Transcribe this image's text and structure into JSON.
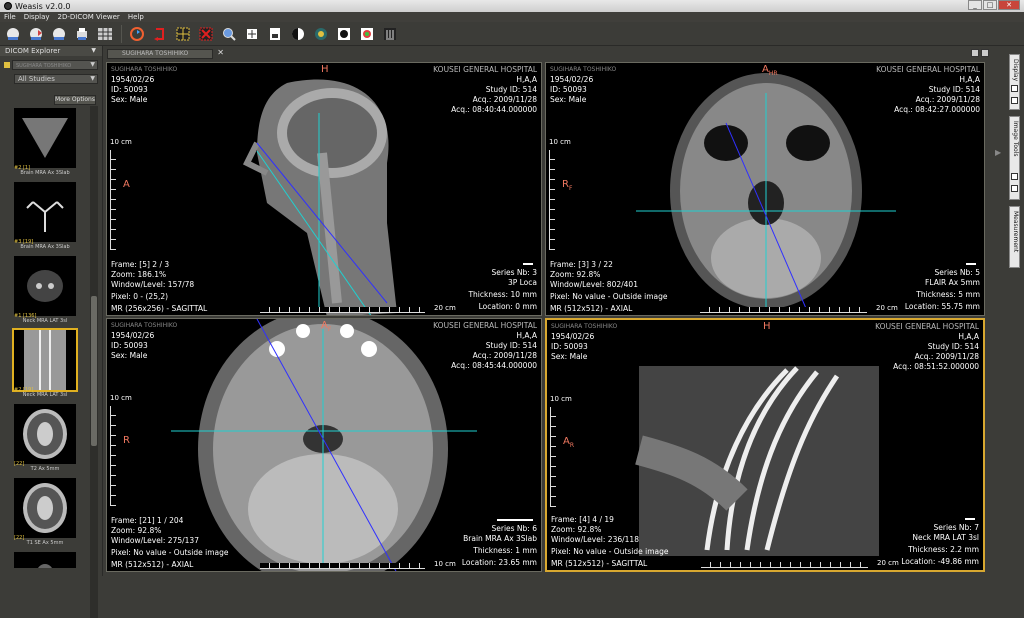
{
  "window": {
    "title": "Weasis v2.0.0"
  },
  "menu": [
    "File",
    "Display",
    "2D-DICOM Viewer",
    "Help"
  ],
  "toolbar": {
    "icons": [
      "open-dicom-icon",
      "import-dicom-icon",
      "export-dicom-icon",
      "print-icon",
      "layout-grid-icon",
      "synchronize-icon",
      "reset-icon",
      "crosshair-icon",
      "delete-icon",
      "zoom-icon",
      "pan-icon",
      "save-icon",
      "contrast-icon",
      "lut-icon",
      "invert-icon",
      "color-lut-icon",
      "filter-icon"
    ]
  },
  "left_panel": {
    "title": "DICOM Explorer",
    "patient": "SUGIHARA TOSHIHIKO",
    "studies": "All Studies",
    "more_options": "More Options",
    "thumbnails": [
      {
        "count": "#2 [1]",
        "label": "Brain MRA Ax 3Slab"
      },
      {
        "count": "#3 [19]",
        "label": "Brain MRA Ax 3Slab"
      },
      {
        "count": "#1 [136]",
        "label": "Neck MRA LAT 3sl"
      },
      {
        "count": "#2 [19]",
        "label": "Neck MRA LAT 3sl"
      },
      {
        "count": "[22]",
        "label": "T2 Ax 5mm"
      },
      {
        "count": "[22]",
        "label": "T1 SE Ax 5mm"
      },
      {
        "count": "",
        "label": ""
      }
    ]
  },
  "tab": {
    "label": "SUGIHARA TOSHIHIKO"
  },
  "viewports": [
    {
      "patient": "SUGIHARA TOSHIHIKO",
      "dob": "1954/02/26",
      "id": "ID: 50093",
      "sex": "Sex: Male",
      "hospital": "KOUSEI GENERAL HOSPITAL",
      "code": "H,A,A",
      "study_id": "Study ID: 514",
      "acq_date": "Acq.: 2009/11/28",
      "acq_time": "Acq.: 08:40:44.000000",
      "frame": "Frame: [5] 2 / 3",
      "zoom": "Zoom: 186.1%",
      "wl": "Window/Level: 157/78",
      "pixel": "Pixel: 0 - (25,2)",
      "mr": "MR (256x256) - SAGITTAL",
      "series": "Series Nb: 3",
      "series_desc": "3P Loca",
      "thickness": "Thickness: 10 mm",
      "location": "Location: 0 mm",
      "orient_top": "H",
      "orient_left": "A",
      "orient_top_sub": "",
      "orient_left_sub": "",
      "scale_v": "10 cm",
      "scale_h": "20 cm"
    },
    {
      "patient": "SUGIHARA TOSHIHIKO",
      "dob": "1954/02/26",
      "id": "ID: 50093",
      "sex": "Sex: Male",
      "hospital": "KOUSEI GENERAL HOSPITAL",
      "code": "H,A,A",
      "study_id": "Study ID: 514",
      "acq_date": "Acq.: 2009/11/28",
      "acq_time": "Acq.: 08:42:27.000000",
      "frame": "Frame: [3] 3 / 22",
      "zoom": "Zoom: 92.8%",
      "wl": "Window/Level: 802/401",
      "pixel": "Pixel: No value - Outside image",
      "mr": "MR (512x512) - AXIAL",
      "series": "Series Nb: 5",
      "series_desc": "FLAIR Ax 5mm",
      "thickness": "Thickness: 5 mm",
      "location": "Location: 55.75 mm",
      "orient_top": "A",
      "orient_left": "R",
      "orient_top_sub": "HR",
      "orient_left_sub": "F",
      "scale_v": "10 cm",
      "scale_h": "20 cm"
    },
    {
      "patient": "SUGIHARA TOSHIHIKO",
      "dob": "1954/02/26",
      "id": "ID: 50093",
      "sex": "Sex: Male",
      "hospital": "KOUSEI GENERAL HOSPITAL",
      "code": "H,A,A",
      "study_id": "Study ID: 514",
      "acq_date": "Acq.: 2009/11/28",
      "acq_time": "Acq.: 08:45:44.000000",
      "frame": "Frame: [21] 1 / 204",
      "zoom": "Zoom: 92.8%",
      "wl": "Window/Level: 275/137",
      "pixel": "Pixel: No value - Outside image",
      "mr": "MR (512x512) - AXIAL",
      "series": "Series Nb: 6",
      "series_desc": "Brain MRA Ax 3Slab",
      "thickness": "Thickness: 1 mm",
      "location": "Location: 23.65 mm",
      "orient_top": "A",
      "orient_left": "R",
      "orient_top_sub": "F",
      "orient_left_sub": "",
      "scale_v": "10 cm",
      "scale_h": "10 cm"
    },
    {
      "patient": "SUGIHARA TOSHIHIKO",
      "dob": "1954/02/26",
      "id": "ID: 50093",
      "sex": "Sex: Male",
      "hospital": "KOUSEI GENERAL HOSPITAL",
      "code": "H,A,A",
      "study_id": "Study ID: 514",
      "acq_date": "Acq.: 2009/11/28",
      "acq_time": "Acq.: 08:51:52.000000",
      "frame": "Frame: [4] 4 / 19",
      "zoom": "Zoom: 92.8%",
      "wl": "Window/Level: 236/118",
      "pixel": "Pixel: No value - Outside image",
      "mr": "MR (512x512) - SAGITTAL",
      "series": "Series Nb: 7",
      "series_desc": "Neck MRA LAT 3sl",
      "thickness": "Thickness: 2.2 mm",
      "location": "Location: -49.86 mm",
      "orient_top": "H",
      "orient_left": "A",
      "orient_top_sub": "",
      "orient_left_sub": "R",
      "scale_v": "10 cm",
      "scale_h": "20 cm"
    }
  ],
  "right_panel": {
    "tabs": [
      "Display",
      "Image Tools",
      "Measurement"
    ]
  },
  "colors": {
    "active_border": "#d8a830",
    "orientation": "#f07860",
    "crosshair": "#20d0d0",
    "reference_line": "#3030ff"
  }
}
